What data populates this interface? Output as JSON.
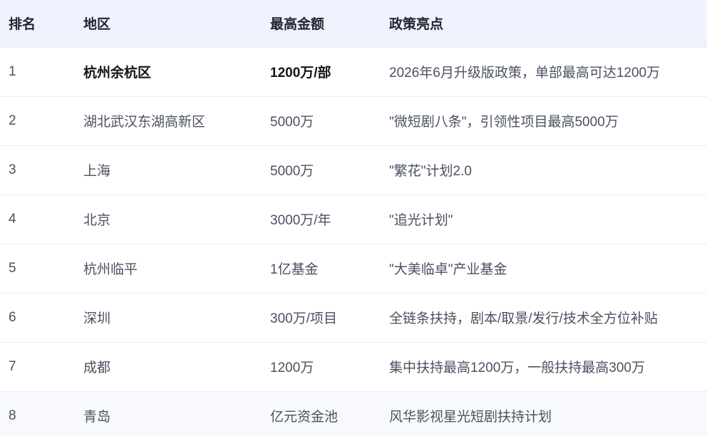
{
  "header": {
    "rank": "排名",
    "region": "地区",
    "max_amount": "最高金额",
    "highlights": "政策亮点"
  },
  "rows": [
    {
      "rank": "1",
      "region": "杭州余杭区",
      "amount": "1200万/部",
      "highlight": "2026年6月升级版政策，单部最高可达1200万",
      "emphasized": true
    },
    {
      "rank": "2",
      "region": "湖北武汉东湖高新区",
      "amount": "5000万",
      "highlight": "\"微短剧八条\"，引领性项目最高5000万"
    },
    {
      "rank": "3",
      "region": "上海",
      "amount": "5000万",
      "highlight": "\"繁花\"计划2.0"
    },
    {
      "rank": "4",
      "region": "北京",
      "amount": "3000万/年",
      "highlight": "\"追光计划\""
    },
    {
      "rank": "5",
      "region": "杭州临平",
      "amount": "1亿基金",
      "highlight": "\"大美临卓\"产业基金"
    },
    {
      "rank": "6",
      "region": "深圳",
      "amount": "300万/项目",
      "highlight": "全链条扶持，剧本/取景/发行/技术全方位补贴"
    },
    {
      "rank": "7",
      "region": "成都",
      "amount": "1200万",
      "highlight": "集中扶持最高1200万，一般扶持最高300万"
    },
    {
      "rank": "8",
      "region": "青岛",
      "amount": "亿元资金池",
      "highlight": "风华影视星光短剧扶持计划"
    }
  ]
}
